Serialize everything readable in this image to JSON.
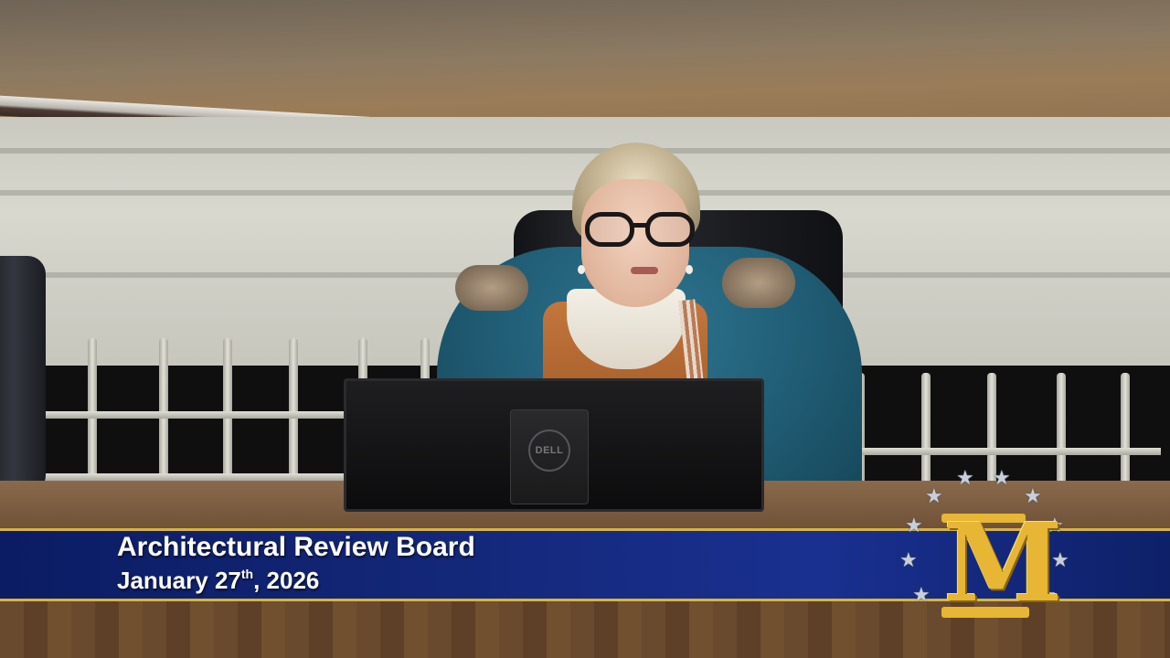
{
  "scene": {
    "description_tag": "meeting-broadcast-frame"
  },
  "lower_third": {
    "title": "Architectural Review Board",
    "date_prefix": "January 27",
    "date_suffix_sup": "th",
    "date_year": ", 2026"
  },
  "monitor": {
    "brand": "DELL"
  },
  "colors": {
    "banner_blue": "#14287a",
    "banner_gold": "#d8b440",
    "logo_gold": "#e6b634"
  },
  "logo": {
    "letter": "M",
    "star_count": 12
  }
}
